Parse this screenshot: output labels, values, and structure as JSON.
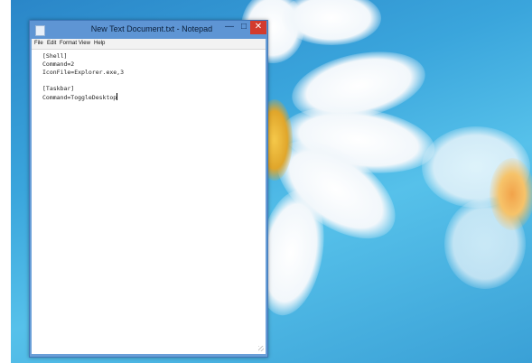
{
  "window": {
    "title": "New Text Document.txt - Notepad",
    "controls": {
      "minimize": "—",
      "maximize": "□",
      "close": "✕"
    }
  },
  "menubar": {
    "items": [
      "File",
      "Edit",
      "Format",
      "View",
      "Help"
    ]
  },
  "editor": {
    "lines": [
      "[Shell]",
      "Command=2",
      "IconFile=Explorer.exe,3",
      "",
      "[Taskbar]",
      "Command=ToggleDesktop"
    ]
  },
  "icons": {
    "app": "notepad-icon",
    "minimize": "minimize-icon",
    "maximize": "maximize-icon",
    "close": "close-icon"
  },
  "colors": {
    "desktop": "#3aa5dc",
    "titlebar": "#5e95d4",
    "close_button": "#d33b2d"
  }
}
